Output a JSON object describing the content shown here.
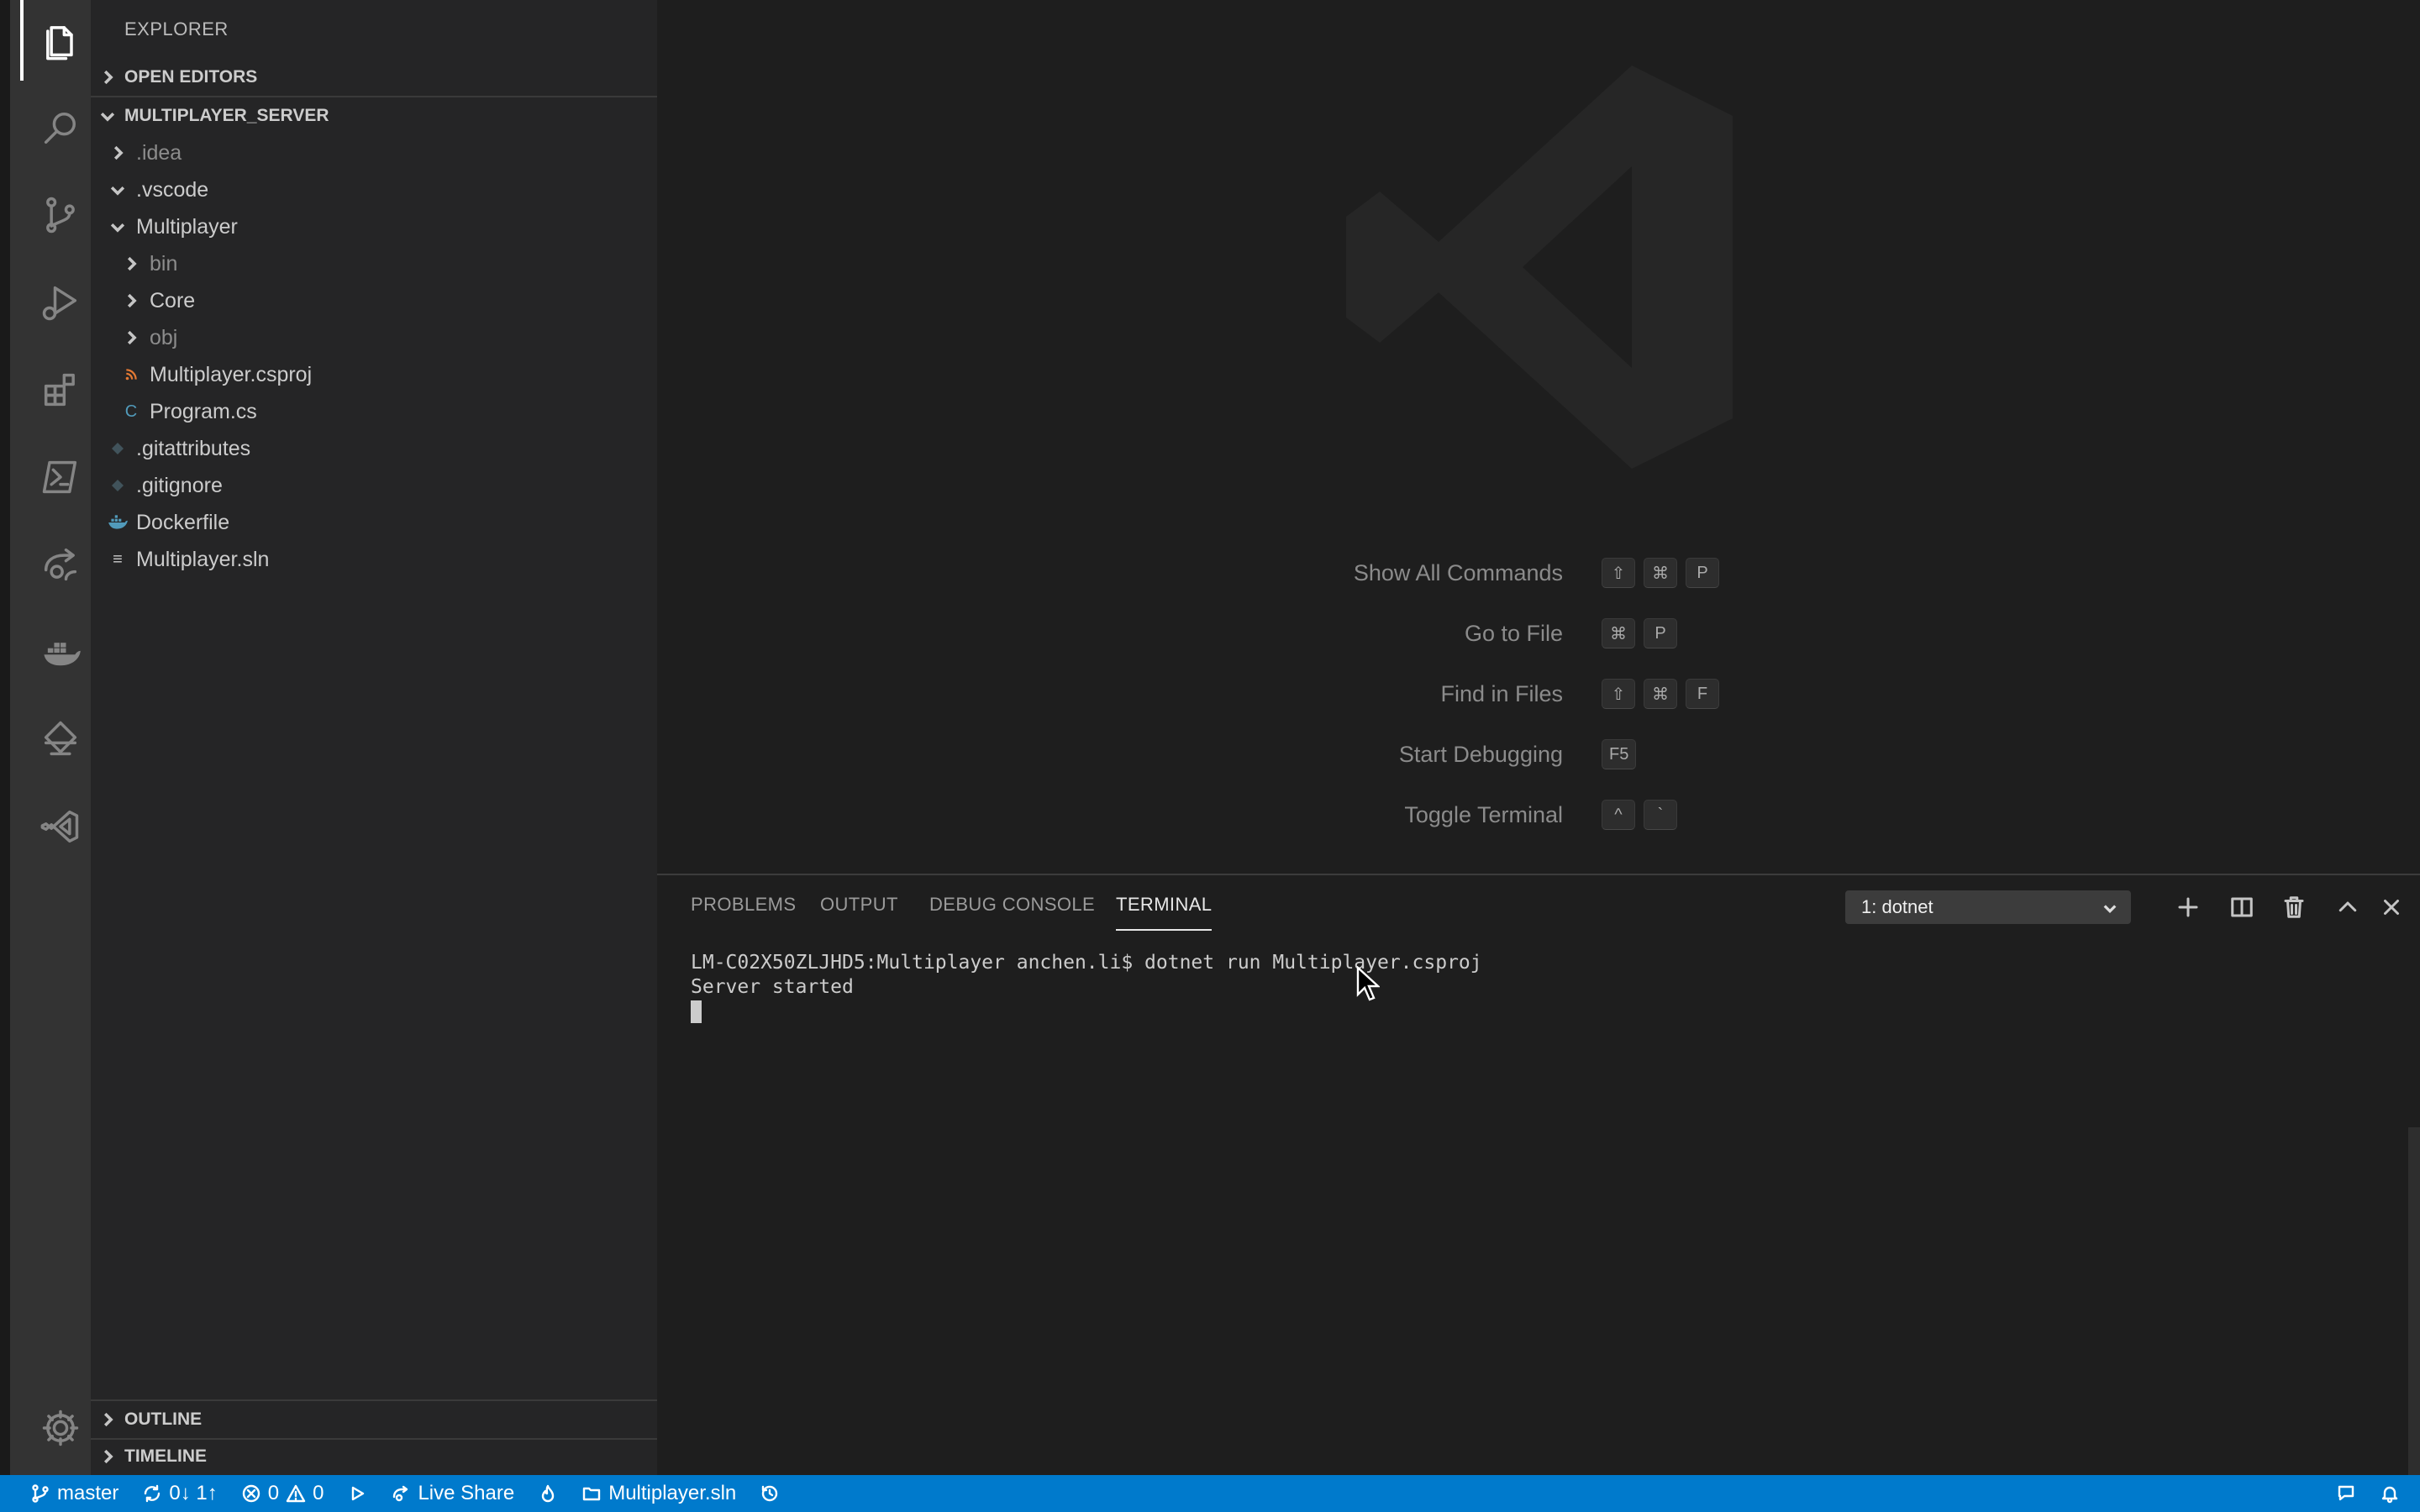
{
  "activity_bar": {
    "icons": [
      "explorer-icon",
      "search-icon",
      "source-control-icon",
      "run-debug-icon",
      "extensions-icon",
      "powershell-icon",
      "live-share-icon",
      "docker-icon",
      "kubernetes-icon",
      "visual-studio-icon",
      "settings-gear-icon"
    ]
  },
  "sidebar": {
    "title": "EXPLORER",
    "open_editors": "OPEN EDITORS",
    "project": "MULTIPLAYER_SERVER",
    "tree": [
      {
        "label": ".idea",
        "type": "folder",
        "expanded": false,
        "dim": true
      },
      {
        "label": ".vscode",
        "type": "folder",
        "expanded": true,
        "dim": false
      },
      {
        "label": "Multiplayer",
        "type": "folder",
        "expanded": true,
        "dim": false
      },
      {
        "label": "bin",
        "type": "folder",
        "expanded": false,
        "dim": true
      },
      {
        "label": "Core",
        "type": "folder",
        "expanded": false,
        "dim": false
      },
      {
        "label": "obj",
        "type": "folder",
        "expanded": false,
        "dim": true
      },
      {
        "label": "Multiplayer.csproj",
        "type": "file",
        "icon": "rss-icon"
      },
      {
        "label": "Program.cs",
        "type": "file",
        "icon": "csharp-icon"
      },
      {
        "label": ".gitattributes",
        "type": "file",
        "icon": "git-icon"
      },
      {
        "label": ".gitignore",
        "type": "file",
        "icon": "git-icon"
      },
      {
        "label": "Dockerfile",
        "type": "file",
        "icon": "docker-file-icon"
      },
      {
        "label": "Multiplayer.sln",
        "type": "file",
        "icon": "lines-icon"
      }
    ],
    "outline": "OUTLINE",
    "timeline": "TIMELINE"
  },
  "welcome": {
    "shortcuts": [
      {
        "label": "Show All Commands",
        "keys": [
          "⇧",
          "⌘",
          "P"
        ]
      },
      {
        "label": "Go to File",
        "keys": [
          "⌘",
          "P"
        ]
      },
      {
        "label": "Find in Files",
        "keys": [
          "⇧",
          "⌘",
          "F"
        ]
      },
      {
        "label": "Start Debugging",
        "keys": [
          "F5"
        ]
      },
      {
        "label": "Toggle Terminal",
        "keys": [
          "^",
          "`"
        ]
      }
    ]
  },
  "panel": {
    "tabs": [
      "PROBLEMS",
      "OUTPUT",
      "DEBUG CONSOLE",
      "TERMINAL"
    ],
    "active_tab": "TERMINAL",
    "terminal_select": "1: dotnet",
    "terminal_lines": [
      "LM-C02X50ZLJHD5:Multiplayer anchen.li$ dotnet run Multiplayer.csproj",
      "Server started"
    ]
  },
  "statusbar": {
    "branch": "master",
    "sync": "0↓ 1↑",
    "errors": "0",
    "warnings": "0",
    "live_share": "Live Share",
    "solution": "Multiplayer.sln"
  },
  "colors": {
    "accent": "#007acc",
    "sidebar_bg": "#252526",
    "editor_bg": "#1e1e1e",
    "activity_bg": "#333333"
  }
}
